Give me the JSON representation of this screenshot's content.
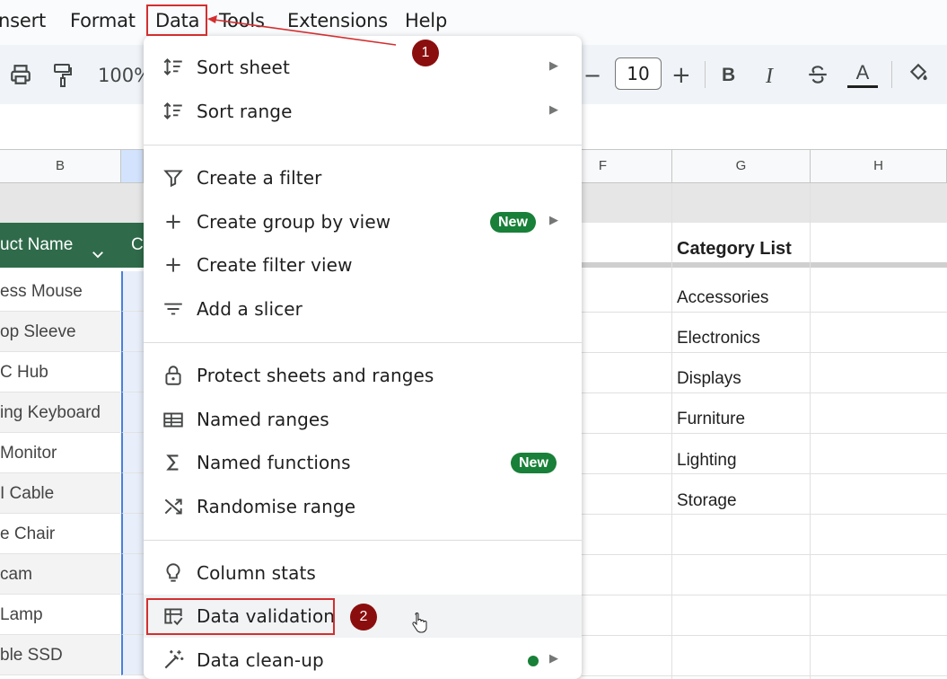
{
  "menubar": {
    "items": [
      "nsert",
      "Format",
      "Data",
      "Tools",
      "Extensions",
      "Help"
    ]
  },
  "toolbar": {
    "zoom": "100%",
    "font_size": "10",
    "bold": "B",
    "italic": "I",
    "text_color_glyph": "A"
  },
  "columns": {
    "b": "B",
    "f": "F",
    "g": "G",
    "h": "H"
  },
  "sheet": {
    "product_header": "uct Name",
    "next_header_fragment": "C",
    "products": [
      "ess Mouse",
      "op Sleeve",
      "C Hub",
      "ing Keyboard",
      "Monitor",
      "I Cable",
      "e Chair",
      "cam",
      "Lamp",
      "ble SSD"
    ],
    "category_title": "Category List",
    "categories": [
      "Accessories",
      "Electronics",
      "Displays",
      "Furniture",
      "Lighting",
      "Storage"
    ]
  },
  "data_menu": {
    "items": [
      {
        "label": "Sort sheet"
      },
      {
        "label": "Sort range"
      },
      {
        "label": "Create a filter"
      },
      {
        "label": "Create group by view",
        "badge": "New"
      },
      {
        "label": "Create filter view"
      },
      {
        "label": "Add a slicer"
      },
      {
        "label": "Protect sheets and ranges"
      },
      {
        "label": "Named ranges"
      },
      {
        "label": "Named functions",
        "badge": "New"
      },
      {
        "label": "Randomise range"
      },
      {
        "label": "Column stats"
      },
      {
        "label": "Data validation"
      },
      {
        "label": "Data clean-up"
      }
    ]
  },
  "annotations": {
    "step1": "1",
    "step2": "2"
  },
  "colors": {
    "header_green": "#2f6b4a",
    "badge_green": "#188038",
    "annotation_red": "#d32f2f",
    "step_badge": "#8b0e0e"
  }
}
